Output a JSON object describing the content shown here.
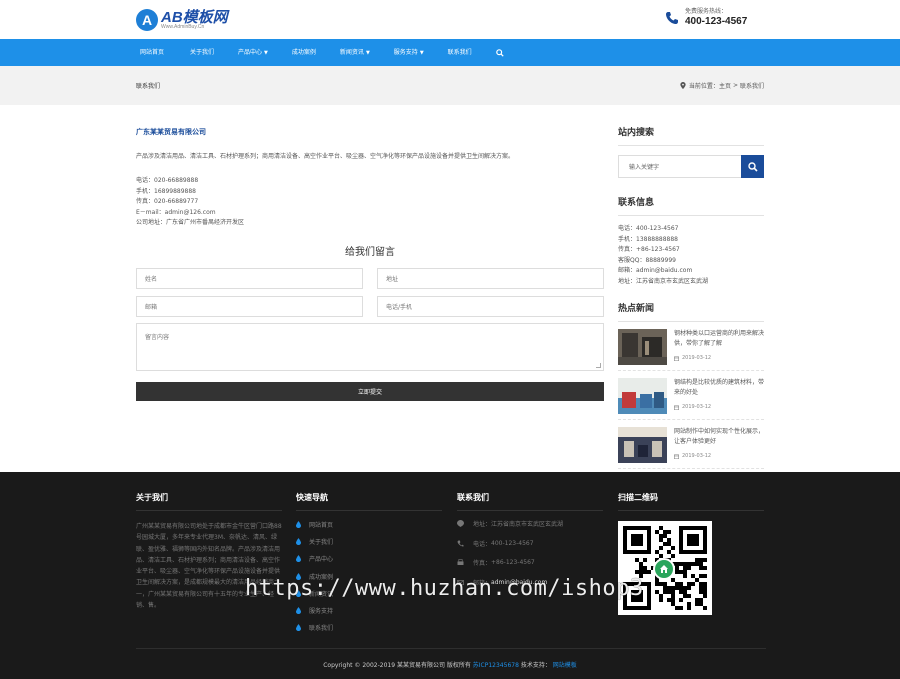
{
  "header": {
    "logo_letter": "A",
    "logo_text": "AB模板网",
    "logo_sub": "Www.AdminBuy.Cn",
    "hotline_label": "免费服务热线：",
    "hotline_number": "400-123-4567"
  },
  "nav": {
    "items": [
      {
        "label": "网站首页",
        "caret": false
      },
      {
        "label": "关于我们",
        "caret": false
      },
      {
        "label": "产品中心",
        "caret": true
      },
      {
        "label": "成功案例",
        "caret": false
      },
      {
        "label": "新闻资讯",
        "caret": true
      },
      {
        "label": "服务支持",
        "caret": true
      },
      {
        "label": "联系我们",
        "caret": false
      }
    ],
    "search_icon": "search-icon"
  },
  "breadcrumb_bar": {
    "title": "联系我们",
    "location_label": "当前位置：",
    "home": "主页",
    "sep": ">",
    "current": "联系我们"
  },
  "company": {
    "name": "广东某某贸易有限公司",
    "desc": "产品涉及清洁用品、清洁工具、石材护理系列；商用清洁设备、高空作业平台、吸尘器、空气净化等环保产品设施设备并提供卫生间解决方案。",
    "lines": [
      "电话：020-66889888",
      "手机：16899889888",
      "传真：020-66889777",
      "E－mail：admin@126.com",
      "公司地址：广东省广州市番禺经济开发区"
    ]
  },
  "form": {
    "title": "给我们留言",
    "name_placeholder": "姓名",
    "address_placeholder": "地址",
    "email_placeholder": "邮箱",
    "phone_placeholder": "电话/手机",
    "message_placeholder": "留言内容",
    "submit_label": "立即提交"
  },
  "sidebar": {
    "search_title": "站内搜索",
    "search_placeholder": "输入关键字",
    "contact_title": "联系信息",
    "contact_lines": [
      "电话：400-123-4567",
      "手机：13888888888",
      "传真：+86-123-4567",
      "客服QQ：88889999",
      "邮箱：admin@baidu.com",
      "地址：江苏省南京市玄武区玄武湖"
    ],
    "news_title": "热点新闻",
    "news": [
      {
        "title": "钢材种类以口运营商的利用来解决供，带你了解了解",
        "date": "2019-03-12"
      },
      {
        "title": "钢结构是比较优质的建筑材料，带来的好处",
        "date": "2019-03-12"
      },
      {
        "title": "网站制作中如何实现个性化展示，让客户体验更好",
        "date": "2019-03-12"
      }
    ]
  },
  "footer": {
    "about_title": "关于我们",
    "about_text": "广州某某贸易有限公司地处于成都市金牛区营门口路88号园城大厦，多年来专业代理3M、奈帆达、清风、绿联、盈优雅、福狮等国内外知名品牌。产品涉及清洁用品、清洁工具、石材护理系列；商用清洁设备、高空作业平台、吸尘器、空气净化等环保产品设施设备并提供卫生间解决方案，是成都规模最大的清洁用品经销商之一，广州某某贸易有限公司有十五年的专业生产、经销、售。",
    "quick_title": "快速导航",
    "quick_items": [
      "网站首页",
      "关于我们",
      "产品中心",
      "成功案例",
      "新闻资讯",
      "服务支持",
      "联系我们"
    ],
    "contact_title": "联系我们",
    "contact_items": [
      {
        "label": "地址：",
        "value": "江苏省南京市玄武区玄武湖",
        "icon": "pin-icon"
      },
      {
        "label": "电话：",
        "value": "400-123-4567",
        "icon": "phone-icon"
      },
      {
        "label": "传真：",
        "value": "+86-123-4567",
        "icon": "fax-icon"
      },
      {
        "label": "邮箱：",
        "value": "admin@baidu.com",
        "icon": "mail-icon"
      }
    ],
    "qr_title": "扫描二维码",
    "copyright_prefix": "Copyright © 2002-2019 某某贸易有限公司 版权所有",
    "icp": "苏ICP12345678",
    "support_label": "技术支持：",
    "support_link": "网站模板"
  },
  "watermark": "https://www.huzhan.com/ishop3"
}
